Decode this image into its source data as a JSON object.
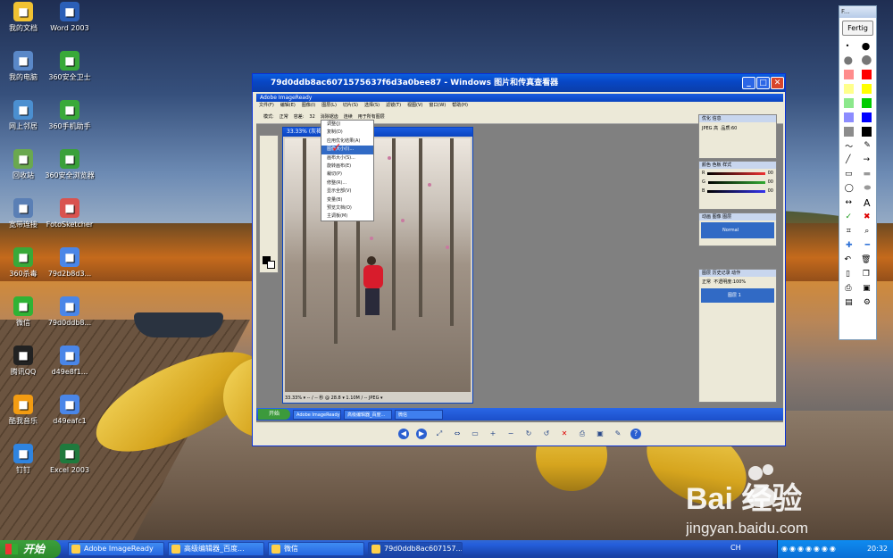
{
  "desktop": {
    "icons": [
      {
        "label": "我的文档",
        "icon": "documents-icon",
        "color": "#f1c232"
      },
      {
        "label": "Word 2003",
        "icon": "word-icon",
        "color": "#2b5fb7"
      },
      {
        "label": "我的电脑",
        "icon": "computer-icon",
        "color": "#5a88c8"
      },
      {
        "label": "360安全卫士",
        "icon": "360-security-icon",
        "color": "#39a939"
      },
      {
        "label": "网上邻居",
        "icon": "network-icon",
        "color": "#4b8fd0"
      },
      {
        "label": "360手机助手",
        "icon": "360-phone-icon",
        "color": "#39a939"
      },
      {
        "label": "回收站",
        "icon": "recycle-bin-icon",
        "color": "#6aa84f"
      },
      {
        "label": "360安全浏览器",
        "icon": "360-browser-icon",
        "color": "#3aa03a"
      },
      {
        "label": "宽带连接",
        "icon": "broadband-icon",
        "color": "#5a7fb5"
      },
      {
        "label": "FotoSketcher",
        "icon": "fotosketcher-icon",
        "color": "#d9534f"
      },
      {
        "label": "360杀毒",
        "icon": "360-antivirus-icon",
        "color": "#39a939"
      },
      {
        "label": "79d2b8d3...",
        "icon": "image-file-icon",
        "color": "#4a86e8"
      },
      {
        "label": "微信",
        "icon": "wechat-icon",
        "color": "#2fb335"
      },
      {
        "label": "79d0ddb8...",
        "icon": "image-file-icon",
        "color": "#4a86e8"
      },
      {
        "label": "腾讯QQ",
        "icon": "qq-icon",
        "color": "#222222"
      },
      {
        "label": "d49e8f1...",
        "icon": "image-file-icon",
        "color": "#4a86e8"
      },
      {
        "label": "酷我音乐",
        "icon": "kuwo-music-icon",
        "color": "#f39c12"
      },
      {
        "label": "d49eafc1",
        "icon": "image-file-icon",
        "color": "#4a86e8"
      },
      {
        "label": "钉钉",
        "icon": "dingtalk-icon",
        "color": "#2f84e0"
      },
      {
        "label": "Excel 2003",
        "icon": "excel-icon",
        "color": "#1f7a3d"
      }
    ]
  },
  "toolpanel": {
    "title": "F...",
    "done_label": "Fertig",
    "colors": [
      "#ff0000",
      "#ffff00",
      "#00cc00",
      "#0000ff",
      "#000000"
    ]
  },
  "viewer": {
    "title": "79d0ddb8ac6071575637f6d3a0bee87 - Windows 图片和传真查看器",
    "minimize": "_",
    "maximize": "□",
    "close": "✕",
    "inner": {
      "app_title": "Adobe ImageReady",
      "menu": [
        "文件(F)",
        "编辑(E)",
        "图像(I)",
        "图层(L)",
        "切片(S)",
        "选择(S)",
        "滤镜(T)",
        "视图(V)",
        "窗口(W)",
        "帮助(H)"
      ],
      "options": [
        "模式:",
        "正常",
        "容差:",
        "32",
        "消除锯齿",
        "连续",
        "用于所有图层"
      ],
      "image_menu": [
        "调整(J)",
        "复制(D)",
        "应用优化结果(A)",
        "图像大小(I)...",
        "画布大小(S)...",
        "旋转画布(E)",
        "裁切(P)",
        "修整(R)...",
        "显示全部(V)",
        "变量(B)",
        "预览文档(O)",
        "主调板(M)"
      ],
      "doc_title": "33.33% (灰褐)",
      "doc_status": "33.33% ▾ -- / -- 秒 @ 28.8 ▾ 1.10M / -- JPEG ▾",
      "panels": {
        "optimize_title": "优化 信息",
        "optimize_format": "JPEG 高",
        "optimize_quality_label": "品质:",
        "optimize_quality": "60",
        "color_title": "颜色 色板 样式",
        "rgb": [
          "R",
          "G",
          "B"
        ],
        "rgb_values": [
          "00",
          "00",
          "00"
        ],
        "animation_title": "动画 图像 图层",
        "animation_item": "Normal",
        "layers_title": "图层 历史记录 动作",
        "layers_mode": "正常",
        "layers_opacity_label": "不透明度:",
        "layers_opacity": "100%",
        "layer_name": "图层 1"
      },
      "taskbar": [
        "开始",
        "Adobe ImageReady",
        "高级编辑器_百度...",
        "微信"
      ]
    },
    "toolbar": [
      "prev-icon",
      "next-icon",
      "best-fit-icon",
      "actual-size-icon",
      "slideshow-icon",
      "zoom-in-icon",
      "zoom-out-icon",
      "rotate-cw-icon",
      "rotate-ccw-icon",
      "delete-icon",
      "print-icon",
      "save-icon",
      "edit-icon",
      "help-icon"
    ]
  },
  "taskbar": {
    "start": "开始",
    "buttons": [
      {
        "label": "Adobe ImageReady",
        "active": false
      },
      {
        "label": "高级编辑器_百度...",
        "active": false
      },
      {
        "label": "微信",
        "active": false
      },
      {
        "label": "79d0ddb8ac607157...",
        "active": true
      }
    ],
    "ime": "CH",
    "clock": "20:32"
  },
  "watermark": {
    "brand": "Bai 经验",
    "url": "jingyan.baidu.com"
  }
}
